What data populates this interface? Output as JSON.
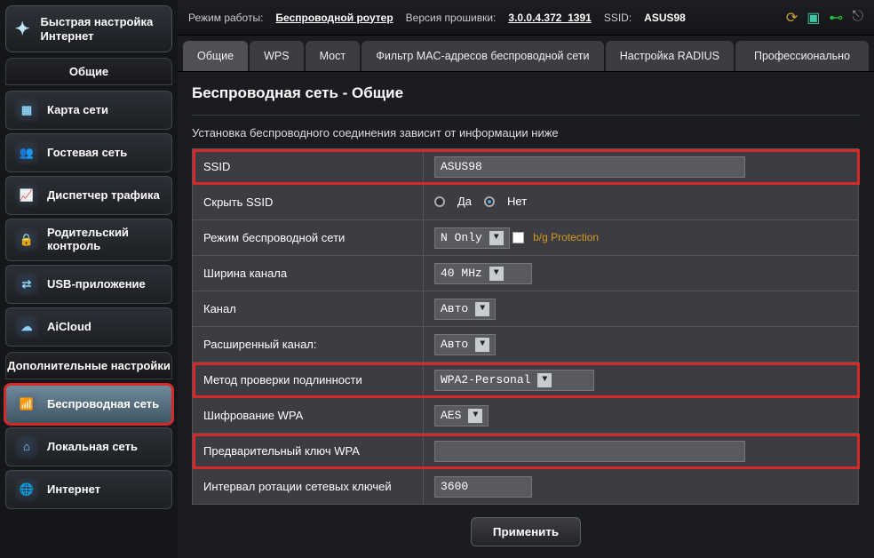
{
  "topbar": {
    "mode_label": "Режим работы:",
    "mode_value": "Беспроводной роутер",
    "fw_label": "Версия прошивки:",
    "fw_value": "3.0.0.4.372_1391",
    "ssid_label": "SSID:",
    "ssid_value": "ASUS98"
  },
  "quick_setup": {
    "title": "Быстрая настройка Интернет"
  },
  "sidebar": {
    "general_header": "Общие",
    "general_items": [
      {
        "label": "Карта сети",
        "icon": "network-map-icon"
      },
      {
        "label": "Гостевая сеть",
        "icon": "guest-network-icon"
      },
      {
        "label": "Диспетчер трафика",
        "icon": "traffic-manager-icon"
      },
      {
        "label": "Родительский контроль",
        "icon": "parental-control-icon"
      },
      {
        "label": "USB-приложение",
        "icon": "usb-app-icon"
      },
      {
        "label": "AiCloud",
        "icon": "aicloud-icon"
      }
    ],
    "advanced_header": "Дополнительные настройки",
    "advanced_items": [
      {
        "label": "Беспроводная сеть",
        "icon": "wireless-icon",
        "active": true
      },
      {
        "label": "Локальная сеть",
        "icon": "lan-icon"
      },
      {
        "label": "Интернет",
        "icon": "internet-icon"
      }
    ]
  },
  "tabs": [
    {
      "label": "Общие",
      "active": true
    },
    {
      "label": "WPS"
    },
    {
      "label": "Мост"
    },
    {
      "label": "Фильтр MAC-адресов беспроводной сети"
    },
    {
      "label": "Настройка RADIUS"
    },
    {
      "label": "Профессионально"
    }
  ],
  "page": {
    "title": "Беспроводная сеть - Общие",
    "description": "Установка беспроводного соединения зависит от информации ниже",
    "apply_label": "Применить"
  },
  "form": {
    "ssid": {
      "label": "SSID",
      "value": "ASUS98"
    },
    "hide_ssid": {
      "label": "Скрыть SSID",
      "yes": "Да",
      "no": "Нет",
      "selected": "no"
    },
    "wireless_mode": {
      "label": "Режим беспроводной сети",
      "value": "N Only",
      "bg_protection_label": "b/g Protection"
    },
    "channel_width": {
      "label": "Ширина канала",
      "value": "40 MHz"
    },
    "channel": {
      "label": "Канал",
      "value": "Авто"
    },
    "ext_channel": {
      "label": "Расширенный канал:",
      "value": "Авто"
    },
    "auth_method": {
      "label": "Метод проверки подлинности",
      "value": "WPA2-Personal"
    },
    "wpa_encryption": {
      "label": "Шифрование WPA",
      "value": "AES"
    },
    "wpa_psk": {
      "label": "Предварительный ключ WPA",
      "value": ""
    },
    "key_rotation": {
      "label": "Интервал ротации сетевых ключей",
      "value": "3600"
    }
  }
}
